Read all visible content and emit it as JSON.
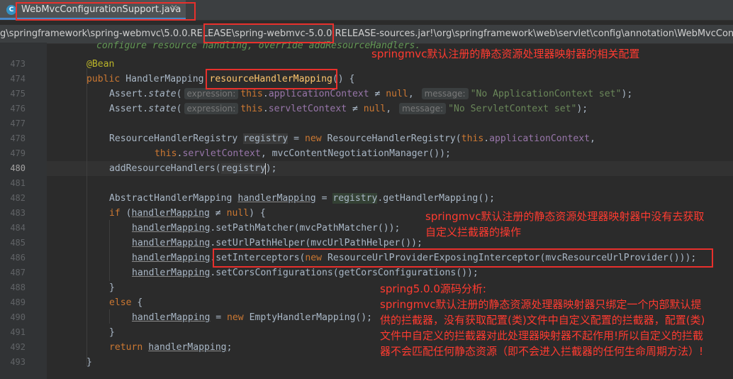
{
  "tab": {
    "title": "WebMvcConfigurationSupport.java",
    "close": "×",
    "icon": "C"
  },
  "breadcrumb": {
    "prefix": "g\\springframework\\spring-webmvc\\5.0.0.RELEASE\\",
    "jar": "spring-webmvc-5.0.0.RELEASE",
    "suffix": "-sources.jar!\\org\\springframework\\web\\servlet\\config\\annotation\\WebMvcConfigurationSupport.j"
  },
  "code": {
    "doc_comment": "configure resource handling, override addResourceHandlers.",
    "bean": "@Bean",
    "method_name": "resourceHandlerMapping",
    "hint_expression": "expression:",
    "hint_message": "message:",
    "msg1": "\"No ApplicationContext set\"",
    "msg2": "\"No ServletContext set\""
  },
  "line_numbers": [
    "473",
    "474",
    "475",
    "476",
    "477",
    "478",
    "479",
    "480",
    "481",
    "482",
    "483",
    "484",
    "485",
    "486",
    "487",
    "488",
    "489",
    "490",
    "491",
    "492",
    "493"
  ],
  "current_line": "480",
  "notes": {
    "top": "springmvc默认注册的静态资源处理器映射器的相关配置",
    "mid1": "springmvc默认注册的静态资源处理器映射器中没有去获取",
    "mid2": "自定义拦截器的操作",
    "b1": "spring5.0.0源码分析:",
    "b2": "springmvc默认注册的静态资源处理器映射器只绑定一个内部默认提",
    "b3": "供的拦截器，没有获取配置(类)文件中自定义配置的拦截器，配置(类)",
    "b4": "文件中自定义的拦截器对此处理器映射器不起作用!所以自定义的拦截",
    "b5": "器不会匹配任何静态资源（即不会进入拦截器的任何生命周期方法）!"
  },
  "colors": {
    "keyword": "#cc7832",
    "annotation_red": "#e8302c",
    "string": "#6a8759",
    "field": "#9876aa",
    "method": "#ffc66d"
  }
}
